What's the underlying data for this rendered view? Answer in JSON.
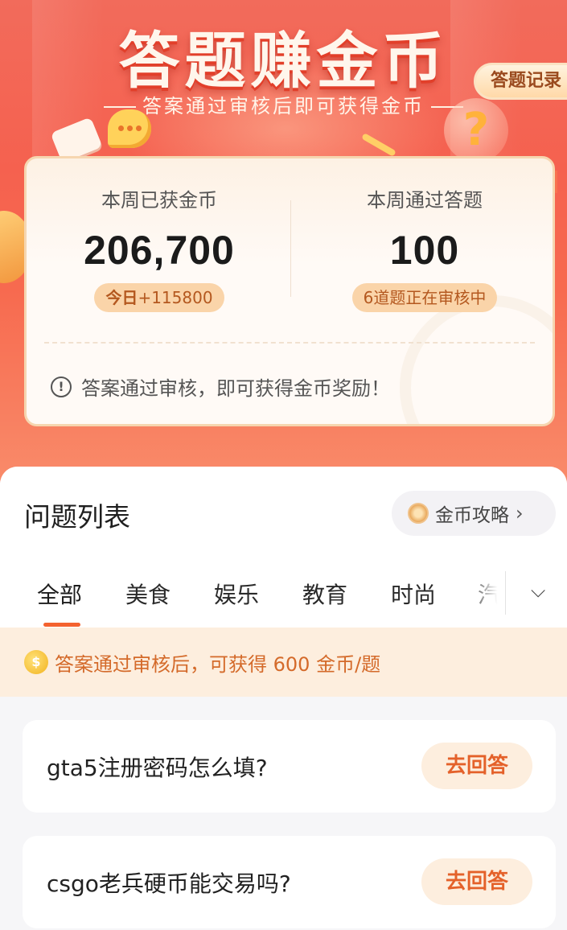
{
  "hero": {
    "title": "答题赚金币",
    "subtitle": "答案通过审核后即可获得金币",
    "record_button": "答题记录"
  },
  "stats": {
    "coins_label": "本周已获金币",
    "coins_value": "206,700",
    "coins_today_prefix": "今日",
    "coins_today_value": "+115800",
    "answers_label": "本周通过答题",
    "answers_value": "100",
    "answers_pending": "6道题正在审核中",
    "notice": "答案通过审核，即可获得金币奖励！"
  },
  "list": {
    "title": "问题列表",
    "guide_button": "金币攻略",
    "tabs": [
      {
        "label": "全部",
        "active": true
      },
      {
        "label": "美食",
        "active": false
      },
      {
        "label": "娱乐",
        "active": false
      },
      {
        "label": "教育",
        "active": false
      },
      {
        "label": "时尚",
        "active": false
      },
      {
        "label": "汽",
        "active": false
      }
    ],
    "reward_info": "答案通过审核后，可获得 600 金币/题",
    "questions": [
      {
        "text": "gta5注册密码怎么填?",
        "button": "去回答"
      },
      {
        "text": "csgo老兵硬币能交易吗?",
        "button": "去回答"
      }
    ]
  },
  "icons": {
    "info": "info-icon",
    "chevron_right": "chevron-right-icon",
    "chevron_down": "chevron-down-icon",
    "coin": "coin-icon"
  },
  "colors": {
    "hero_red": "#f5614f",
    "accent_orange": "#f4622f",
    "badge_bg": "#fad4a9",
    "strip_bg": "#fdeede"
  }
}
